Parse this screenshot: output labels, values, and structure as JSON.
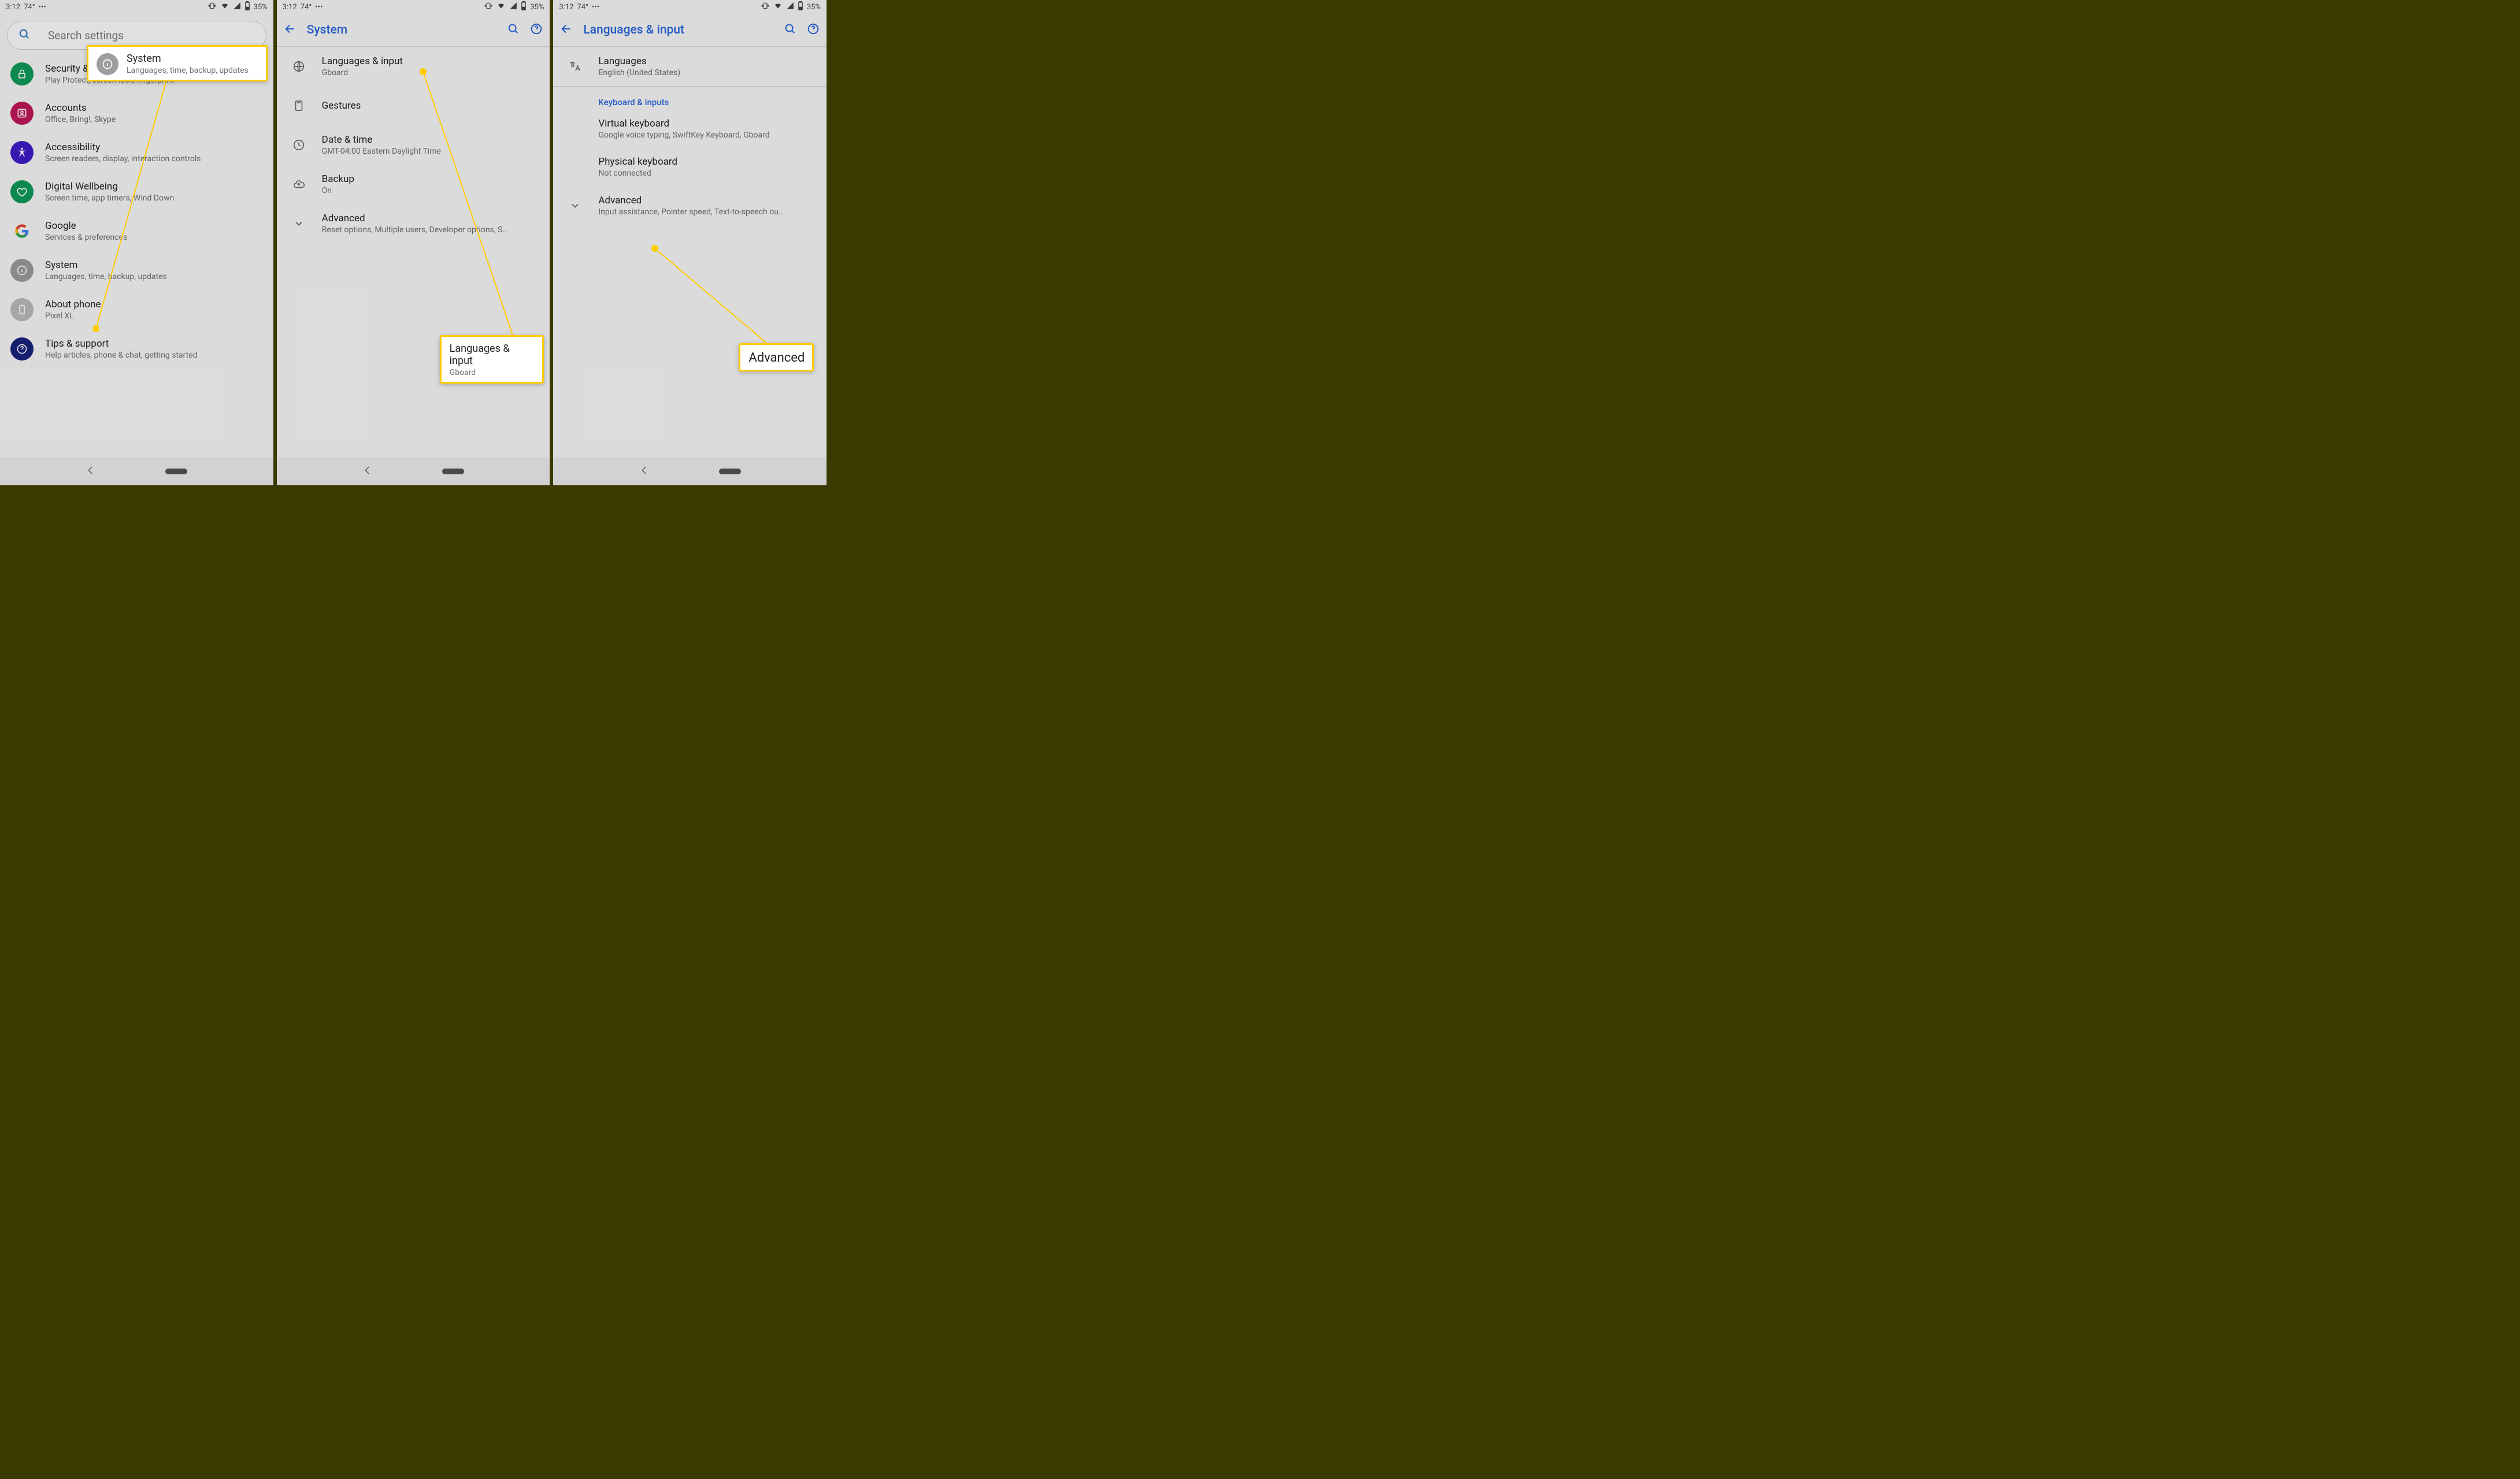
{
  "status": {
    "time": "3:12",
    "temp": "74°",
    "battery": "35%"
  },
  "panel1": {
    "search_placeholder": "Search settings",
    "rows": [
      {
        "title": "Security & location",
        "sub": "Play Protect, screen lock, fingerprint",
        "color": "#0f9d58",
        "icon": "lock"
      },
      {
        "title": "Accounts",
        "sub": "Office, Bring!, Skype",
        "color": "#c2185b",
        "icon": "account"
      },
      {
        "title": "Accessibility",
        "sub": "Screen readers, display, interaction controls",
        "color": "#3f1dcb",
        "icon": "accessibility"
      },
      {
        "title": "Digital Wellbeing",
        "sub": "Screen time, app timers, Wind Down",
        "color": "#0f9d58",
        "icon": "wellbeing"
      },
      {
        "title": "Google",
        "sub": "Services & preferences",
        "color": "#ffffff",
        "icon": "google"
      },
      {
        "title": "System",
        "sub": "Languages, time, backup, updates",
        "color": "#9e9e9e",
        "icon": "info"
      },
      {
        "title": "About phone",
        "sub": "Pixel XL",
        "color": "#bdbdbd",
        "icon": "phone"
      },
      {
        "title": "Tips & support",
        "sub": "Help articles, phone & chat, getting started",
        "color": "#1a237e",
        "icon": "help"
      }
    ],
    "callout": {
      "title": "System",
      "sub": "Languages, time, backup, updates"
    }
  },
  "panel2": {
    "title": "System",
    "rows": [
      {
        "title": "Languages & input",
        "sub": "Gboard",
        "icon": "globe"
      },
      {
        "title": "Gestures",
        "sub": "",
        "icon": "gestures"
      },
      {
        "title": "Date & time",
        "sub": "GMT-04:00 Eastern Daylight Time",
        "icon": "clock"
      },
      {
        "title": "Backup",
        "sub": "On",
        "icon": "cloud"
      },
      {
        "title": "Advanced",
        "sub": "Reset options, Multiple users, Developer options, S..",
        "icon": "chevron"
      }
    ],
    "callout": {
      "title": "Languages & input",
      "sub": "Gboard"
    }
  },
  "panel3": {
    "title": "Languages & input",
    "rows_top": [
      {
        "title": "Languages",
        "sub": "English (United States)",
        "icon": "translate"
      }
    ],
    "section": "Keyboard & inputs",
    "rows_mid": [
      {
        "title": "Virtual keyboard",
        "sub": "Google voice typing, SwiftKey Keyboard, Gboard"
      },
      {
        "title": "Physical keyboard",
        "sub": "Not connected"
      }
    ],
    "row_adv": {
      "title": "Advanced",
      "sub": "Input assistance, Pointer speed, Text-to-speech ou.."
    },
    "callout": {
      "title": "Advanced"
    }
  }
}
